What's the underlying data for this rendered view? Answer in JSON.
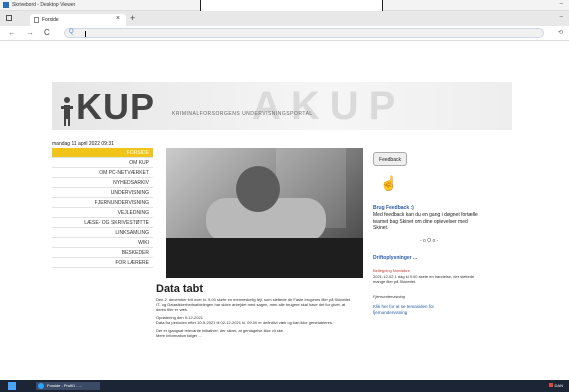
{
  "viewer": {
    "title": "Skrivebord - Desktop Viewer",
    "min": "–"
  },
  "browser": {
    "tab_label": "Forside",
    "tab_close": "×",
    "new_tab": "+",
    "back": "←",
    "forward": "→",
    "reload": "C",
    "search_icon": "Q",
    "address_value": "",
    "min": "–"
  },
  "site": {
    "logo": "KUP",
    "tagline": "KRIMINALFORSORGENS UNDERVISNINGSPORTAL",
    "date": "mandag 11 april 2022 09:31",
    "menu": [
      {
        "label": "FORSIDE",
        "active": true
      },
      {
        "label": "OM KUP"
      },
      {
        "label": "OM PC-NETVÆRKET"
      },
      {
        "label": "NYHEDSARKIV"
      },
      {
        "label": "UNDERVISNING"
      },
      {
        "label": "FJERNUNDERVISNING"
      },
      {
        "label": "VEJLEDNING"
      },
      {
        "label": "LÆSE- OG SKRIVESTØTTE"
      },
      {
        "label": "LINKSAMLING"
      },
      {
        "label": "WIKI"
      },
      {
        "label": "BESKEDER"
      },
      {
        "label": "FOR LÆRERE"
      }
    ],
    "article": {
      "heading": "Data tabt",
      "paragraphs": [
        "Den 2. december fvit over kl. 9.00 skete en menneskelig fejl, som slettede de Faste brugeres filer på Skinettet. IT- og Datasikkerhedsafdelingen har siden arbejdet med sagen, men alle brugere skal have det for givet, at deres filer er væk.",
        "Opdatering den 9-12-2021\nData fra perioden efter 10-5-2021 til 02-12-2021 kl. 09.00 er definitivt væk og kan ikke genetableres.",
        "Der er igangsat relevante initiativer, der sikrer, at gentagelse ikke vil ske.\nMere information følger ..."
      ]
    },
    "feedback": {
      "button": "Feedback",
      "title": "Brug Feedback :)",
      "text": "Med feedback kan du en gang i døgnet fortælle teamet bag Skinet om dine oplevelser med Skinet.",
      "sep": "- o O o -"
    },
    "drift": {
      "title": "Driftoplysninger ...",
      "sub": "Bellegning Nordsikre",
      "text": "2021-12-02 1 dag kl 9.00 skete en handelse, der slettede mange filer på Skinettet.",
      "sub2": "Fjernundervisning",
      "link": "Klik her for at se temasiden for fjernundervisning"
    }
  },
  "taskbar": {
    "app_label": "Forside - Profil1 - ...",
    "tray": "DAN"
  },
  "colors": {
    "menu_active": "#f0c419",
    "link": "#2a5ca8",
    "taskbar": "#1b2536"
  }
}
